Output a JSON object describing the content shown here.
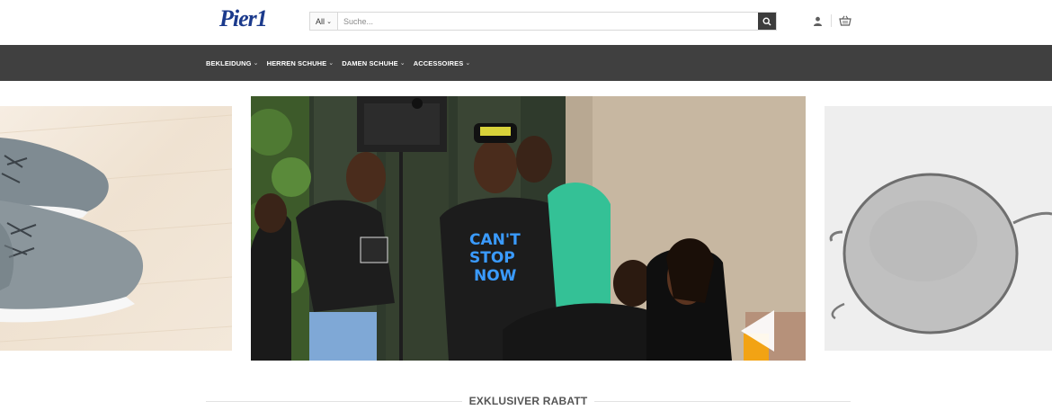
{
  "header": {
    "logo_text": "Pier1",
    "search": {
      "category": "All",
      "placeholder": "Suche..."
    },
    "icons": [
      "user-icon",
      "basket-icon",
      "search-icon"
    ]
  },
  "nav": {
    "items": [
      {
        "label": "BEKLEIDUNG"
      },
      {
        "label": "HERREN SCHUHE"
      },
      {
        "label": "DAMEN SCHUHE"
      },
      {
        "label": "ACCESSOIRES"
      }
    ]
  },
  "slider": {
    "center_shirt_text": "CAN'T STOP NOW",
    "slides": [
      "shoes",
      "party",
      "sunglasses"
    ]
  },
  "section": {
    "title": "EXKLUSIVER RABATT"
  },
  "colors": {
    "nav_bg": "#404040",
    "logo": "#1b3a8c",
    "search_button": "#3c3c3c"
  }
}
